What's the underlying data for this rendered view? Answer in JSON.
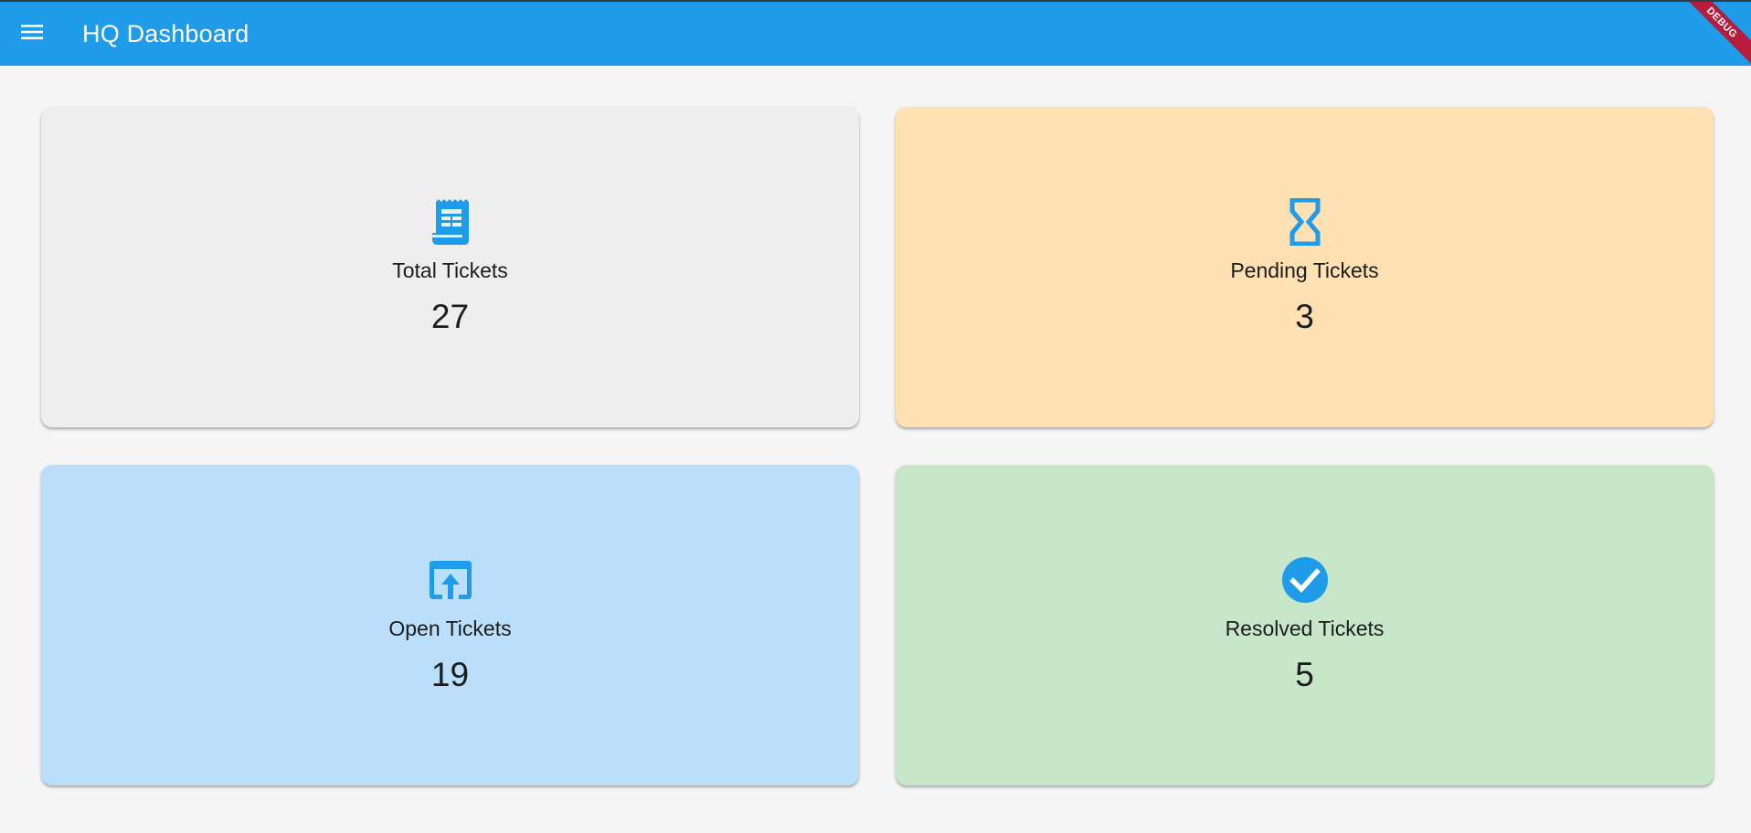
{
  "appbar": {
    "title": "HQ Dashboard",
    "menu_icon": "menu-icon",
    "debug_label": "DEBUG",
    "color": "#1e9be9"
  },
  "cards": [
    {
      "id": "total",
      "label": "Total Tickets",
      "count": "27",
      "icon": "receipt-icon",
      "background": "#eeeeee"
    },
    {
      "id": "pending",
      "label": "Pending Tickets",
      "count": "3",
      "icon": "hourglass-icon",
      "background": "#ffe0b2"
    },
    {
      "id": "open",
      "label": "Open Tickets",
      "count": "19",
      "icon": "open-in-browser-icon",
      "background": "#bbdefb"
    },
    {
      "id": "resolved",
      "label": "Resolved Tickets",
      "count": "5",
      "icon": "check-circle-icon",
      "background": "#c8e6c9"
    }
  ],
  "colors": {
    "accent": "#1e9be9",
    "page_background": "#f5f5f5",
    "text": "#1c1c1c"
  }
}
